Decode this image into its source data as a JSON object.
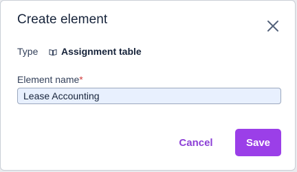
{
  "dialog": {
    "title": "Create element",
    "close_icon": "close-icon",
    "type": {
      "label": "Type",
      "icon": "book-icon",
      "value": "Assignment table"
    },
    "element_name": {
      "label": "Element name",
      "required_marker": "*",
      "value": "Lease Accounting"
    },
    "buttons": {
      "cancel": "Cancel",
      "save": "Save"
    }
  },
  "colors": {
    "accent": "#9b3fe8",
    "cancel_text": "#8c3fd6",
    "required": "#d23b3b",
    "input_background": "#e8f0fe"
  }
}
